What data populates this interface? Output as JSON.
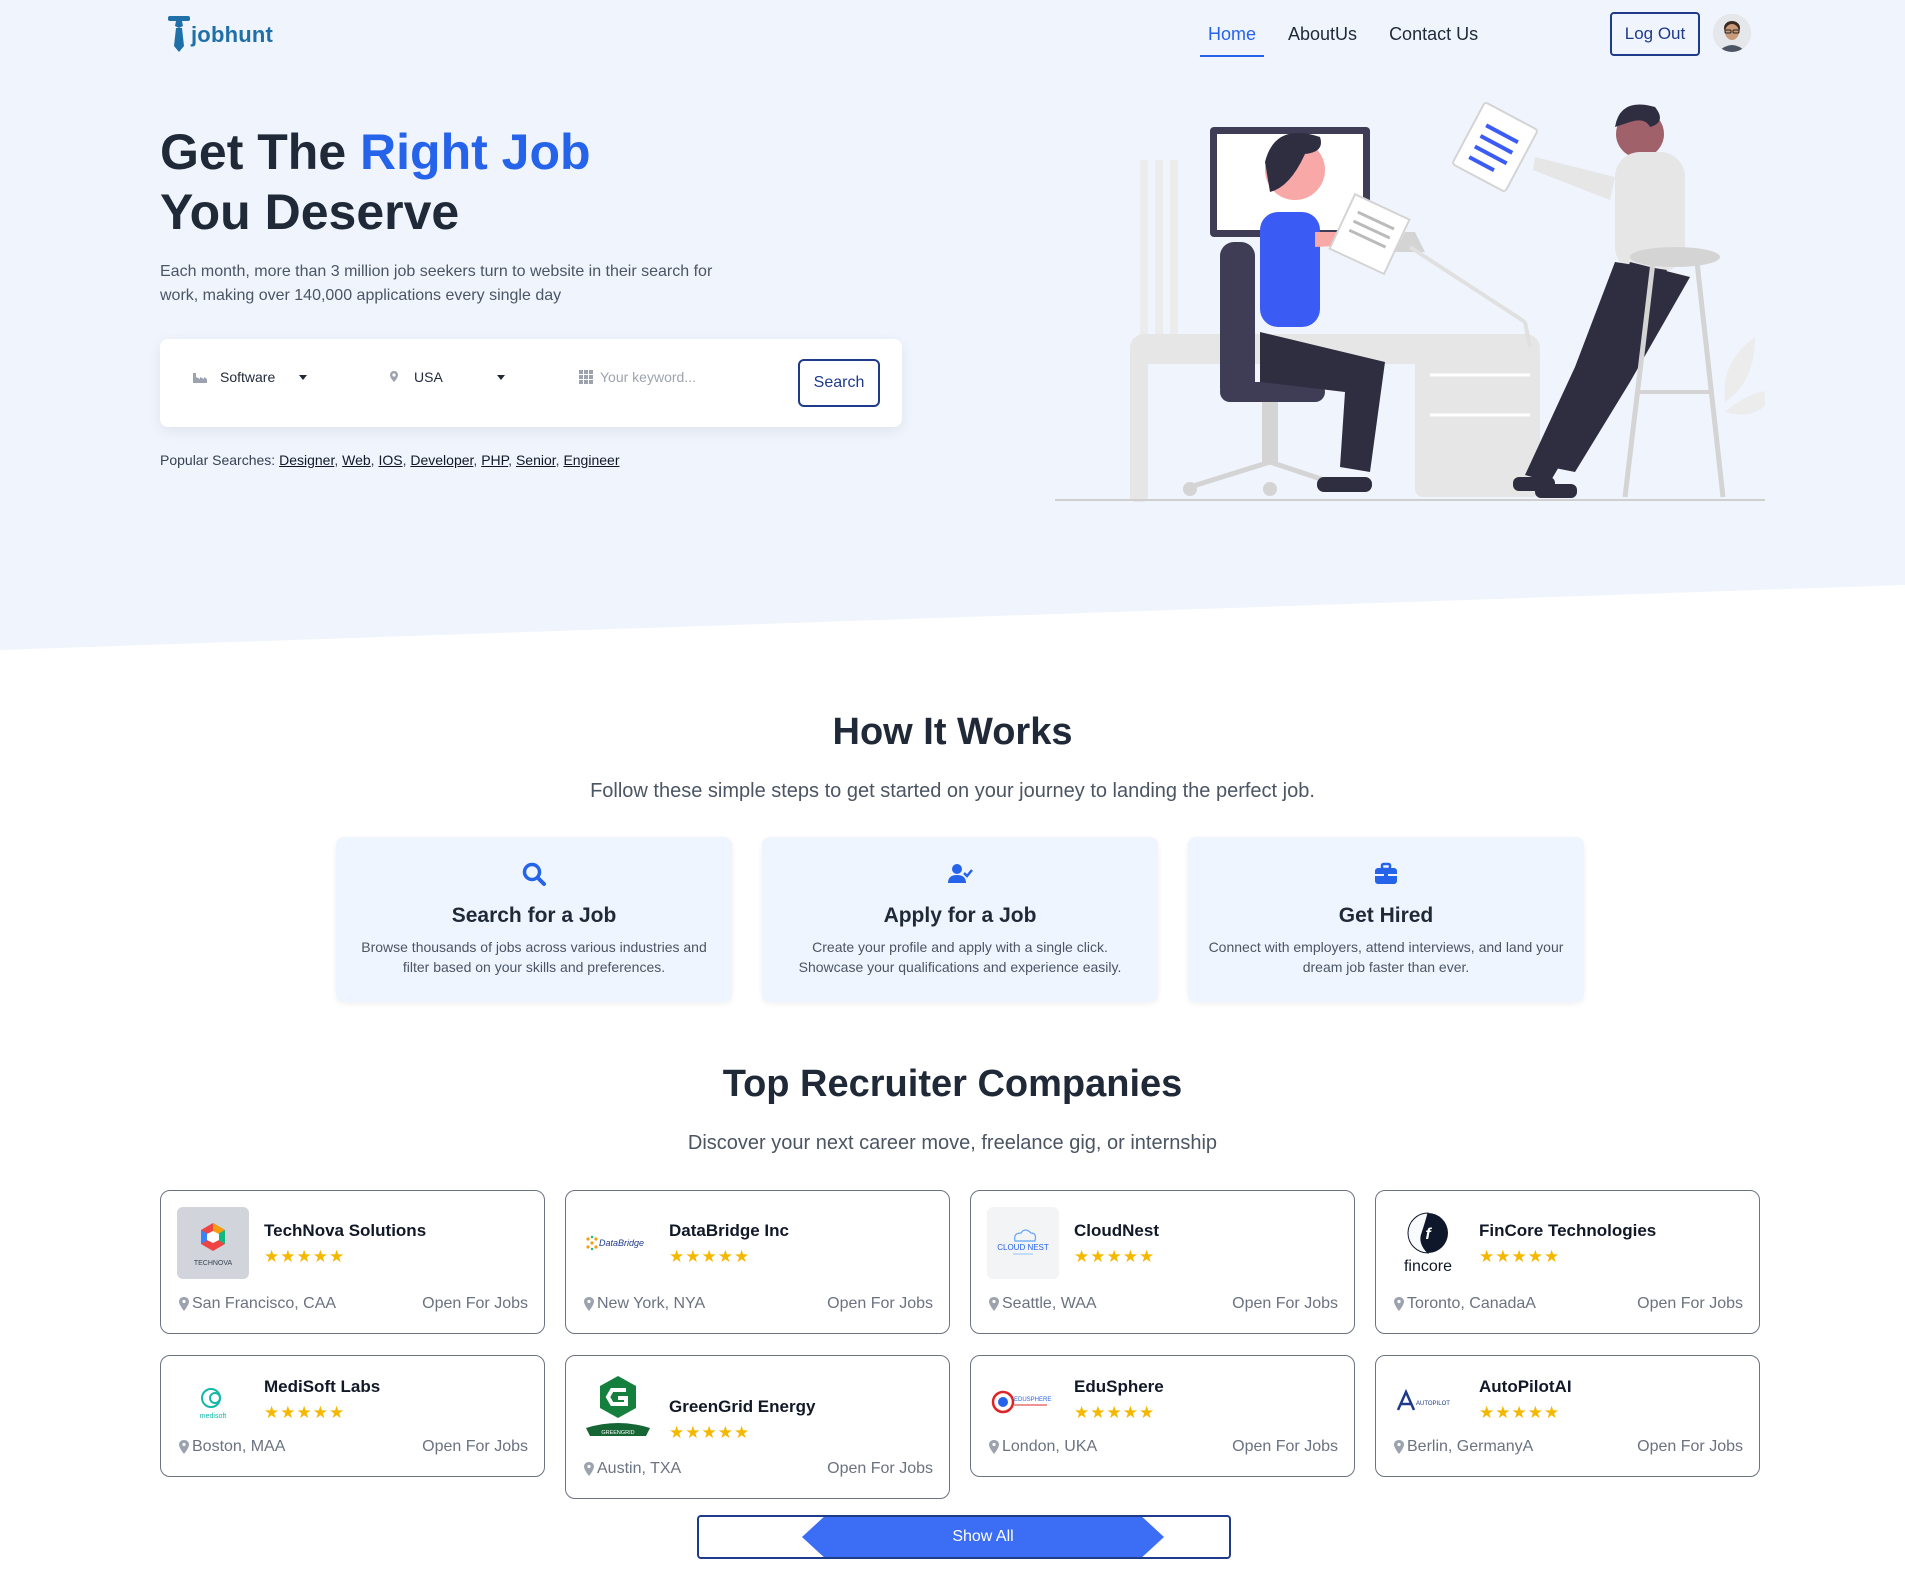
{
  "brand": {
    "name": "jobhunt",
    "accent": "#2563eb",
    "dark": "#1e3a8a"
  },
  "nav": {
    "links": [
      {
        "label": "Home",
        "active": true
      },
      {
        "label": "AboutUs",
        "active": false
      },
      {
        "label": "Contact Us",
        "active": false
      }
    ],
    "logout_label": "Log Out"
  },
  "hero": {
    "title_part1": "Get The ",
    "title_accent": "Right Job",
    "title_line2": "You Deserve",
    "subtitle": "Each month, more than 3 million job seekers turn to website in their search for work, making over 140,000 applications every single day",
    "search": {
      "category_value": "Software",
      "location_value": "USA",
      "keyword_placeholder": "Your keyword...",
      "button_label": "Search"
    },
    "popular_label": "Popular Searches:",
    "popular": [
      "Designer",
      "Web",
      "IOS",
      "Developer",
      "PHP",
      "Senior",
      "Engineer"
    ]
  },
  "how": {
    "title": "How It Works",
    "subtitle": "Follow these simple steps to get started on your journey to landing the perfect job.",
    "steps": [
      {
        "icon": "search-icon",
        "title": "Search for a Job",
        "desc": "Browse thousands of jobs across various industries and filter based on your skills and preferences."
      },
      {
        "icon": "user-check-icon",
        "title": "Apply for a Job",
        "desc": "Create your profile and apply with a single click. Showcase your qualifications and experience easily."
      },
      {
        "icon": "briefcase-icon",
        "title": "Get Hired",
        "desc": "Connect with employers, attend interviews, and land your dream job faster than ever."
      }
    ]
  },
  "companies": {
    "title": "Top Recruiter Companies",
    "subtitle": "Discover your next career move, freelance gig, or internship",
    "open_label": "Open For Jobs",
    "stars": "★★★★★",
    "list": [
      {
        "name": "TechNova Solutions",
        "location": "San Francisco, CAA",
        "logo_text": "TECHNOVA"
      },
      {
        "name": "DataBridge Inc",
        "location": "New York, NYA",
        "logo_text": "DataBridge"
      },
      {
        "name": "CloudNest",
        "location": "Seattle, WAA",
        "logo_text": "CLOUD NEST"
      },
      {
        "name": "FinCore Technologies",
        "location": "Toronto, CanadaA",
        "logo_text": "fincore"
      },
      {
        "name": "MediSoft Labs",
        "location": "Boston, MAA",
        "logo_text": "medisoft"
      },
      {
        "name": "GreenGrid Energy",
        "location": "Austin, TXA",
        "logo_text": "GREENGRID"
      },
      {
        "name": "EduSphere",
        "location": "London, UKA",
        "logo_text": "EDUSPHERE"
      },
      {
        "name": "AutoPilotAI",
        "location": "Berlin, GermanyA",
        "logo_text": "AUTOPILOT"
      }
    ],
    "show_all_label": "Show All"
  }
}
